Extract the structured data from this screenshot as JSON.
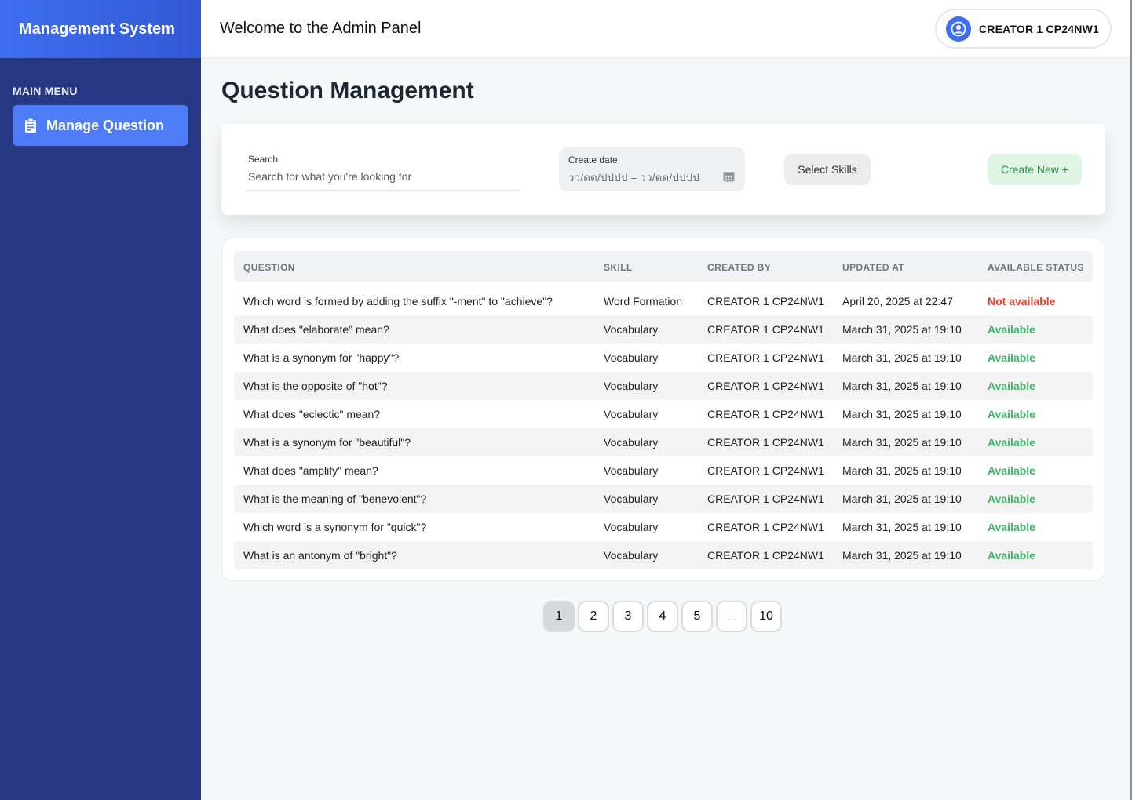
{
  "sidebar": {
    "brand": "Management System",
    "menu_title": "MAIN MENU",
    "items": [
      {
        "label": "Manage Question",
        "icon": "clipboard-icon",
        "active": true
      }
    ]
  },
  "header": {
    "title": "Welcome to the Admin Panel",
    "user": {
      "name": "CREATOR 1 CP24NW1",
      "icon": "user-circle-icon"
    }
  },
  "main": {
    "title": "Question Management",
    "filters": {
      "search_label": "Search",
      "search_placeholder": "Search for what you're looking for",
      "search_value": "",
      "date_label": "Create date",
      "date_value": "วว/ดด/ปปปป – วว/ดด/ปปปป",
      "skills_label": "Select Skills",
      "create_label": "Create New +"
    },
    "table": {
      "headers": [
        "QUESTION",
        "SKILL",
        "CREATED BY",
        "UPDATED AT",
        "AVAILABLE STATUS"
      ],
      "rows": [
        {
          "question": "Which word is formed by adding the suffix \"-ment\" to \"achieve\"?",
          "skill": "Word Formation",
          "created_by": "CREATOR 1 CP24NW1",
          "updated_at": "April 20, 2025 at 22:47",
          "status": "Not available"
        },
        {
          "question": "What does \"elaborate\" mean?",
          "skill": "Vocabulary",
          "created_by": "CREATOR 1 CP24NW1",
          "updated_at": "March 31, 2025 at 19:10",
          "status": "Available"
        },
        {
          "question": "What is a synonym for \"happy\"?",
          "skill": "Vocabulary",
          "created_by": "CREATOR 1 CP24NW1",
          "updated_at": "March 31, 2025 at 19:10",
          "status": "Available"
        },
        {
          "question": "What is the opposite of \"hot\"?",
          "skill": "Vocabulary",
          "created_by": "CREATOR 1 CP24NW1",
          "updated_at": "March 31, 2025 at 19:10",
          "status": "Available"
        },
        {
          "question": "What does \"eclectic\" mean?",
          "skill": "Vocabulary",
          "created_by": "CREATOR 1 CP24NW1",
          "updated_at": "March 31, 2025 at 19:10",
          "status": "Available"
        },
        {
          "question": "What is a synonym for \"beautiful\"?",
          "skill": "Vocabulary",
          "created_by": "CREATOR 1 CP24NW1",
          "updated_at": "March 31, 2025 at 19:10",
          "status": "Available"
        },
        {
          "question": "What does \"amplify\" mean?",
          "skill": "Vocabulary",
          "created_by": "CREATOR 1 CP24NW1",
          "updated_at": "March 31, 2025 at 19:10",
          "status": "Available"
        },
        {
          "question": "What is the meaning of \"benevolent\"?",
          "skill": "Vocabulary",
          "created_by": "CREATOR 1 CP24NW1",
          "updated_at": "March 31, 2025 at 19:10",
          "status": "Available"
        },
        {
          "question": "Which word is a synonym for \"quick\"?",
          "skill": "Vocabulary",
          "created_by": "CREATOR 1 CP24NW1",
          "updated_at": "March 31, 2025 at 19:10",
          "status": "Available"
        },
        {
          "question": "What is an antonym of \"bright\"?",
          "skill": "Vocabulary",
          "created_by": "CREATOR 1 CP24NW1",
          "updated_at": "March 31, 2025 at 19:10",
          "status": "Available"
        }
      ]
    },
    "pagination": [
      "1",
      "2",
      "3",
      "4",
      "5",
      "...",
      "10"
    ],
    "current_page": "1"
  },
  "colors": {
    "sidebar_bg": "#263883",
    "accent": "#4d7cf6",
    "available": "#45b26b",
    "not_available": "#e0422e"
  }
}
